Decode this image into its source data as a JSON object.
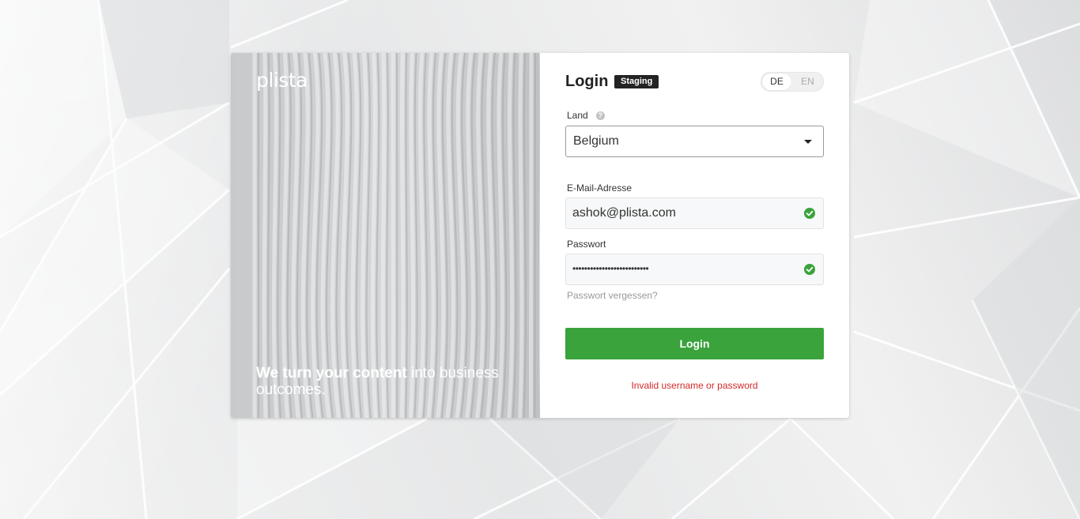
{
  "hero": {
    "logo": "plista",
    "tagline_bold": "We turn your content",
    "tagline_rest": " into business outcomes."
  },
  "login": {
    "title": "Login",
    "env_badge": "Staging",
    "languages": [
      "DE",
      "EN"
    ],
    "active_language": "DE",
    "country": {
      "label": "Land",
      "help_icon": "question-circle-icon",
      "value": "Belgium"
    },
    "email": {
      "label": "E-Mail-Adresse",
      "value": "ashok@plista.com",
      "status_icon": "check-circle-icon"
    },
    "password": {
      "label": "Passwort",
      "masked_value": "••••••••••••••••••••••••••",
      "status_icon": "check-circle-icon"
    },
    "forgot_link": "Passwort vergessen?",
    "submit_label": "Login",
    "error_message": "Invalid username or password"
  },
  "colors": {
    "accent_green": "#3aa33c",
    "error_red": "#d42a2a",
    "badge_dark": "#232323"
  }
}
